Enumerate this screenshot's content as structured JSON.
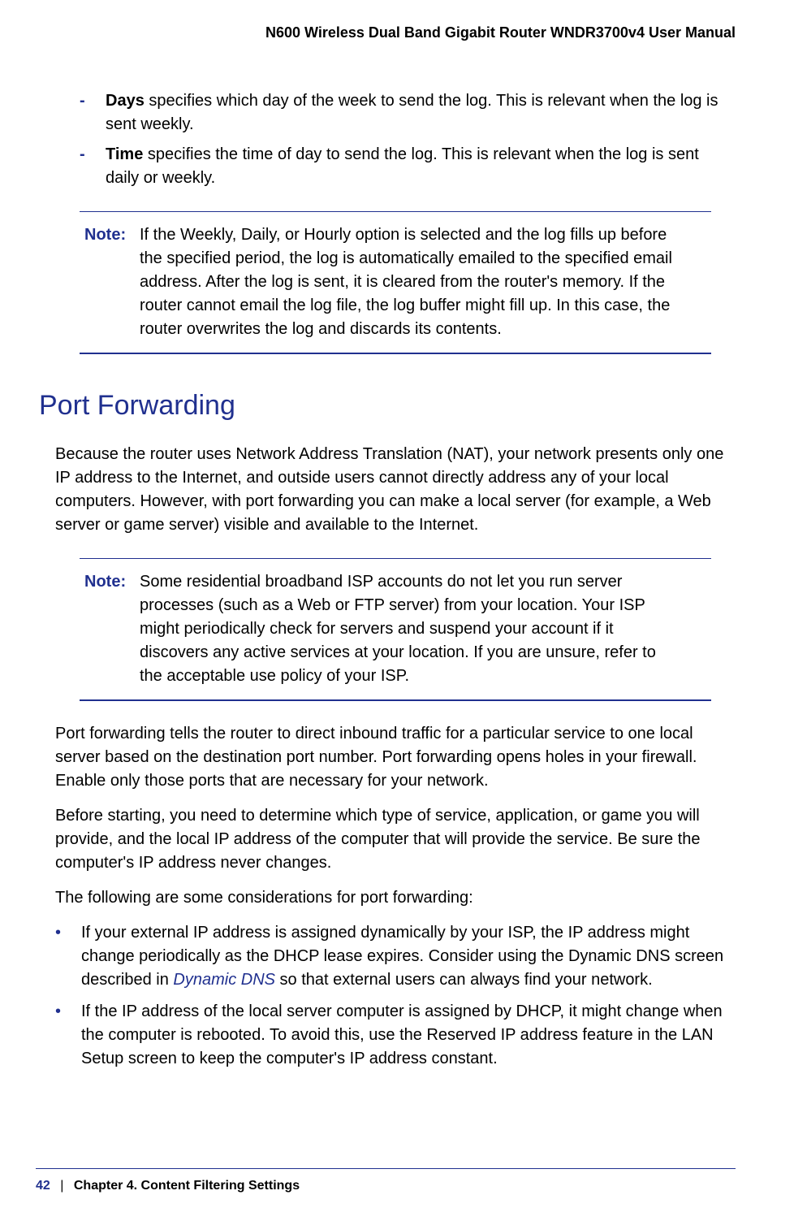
{
  "header": {
    "title": "N600 Wireless Dual Band Gigabit Router WNDR3700v4 User Manual"
  },
  "dash_items": [
    {
      "lead": "Days",
      "rest": " specifies which day of the week to send the log. This is relevant when the log is sent weekly."
    },
    {
      "lead": "Time",
      "rest": " specifies the time of day to send the log. This is relevant when the log is sent daily or weekly."
    }
  ],
  "note1": {
    "label": "Note:",
    "text": "If the Weekly, Daily, or Hourly option is selected and the log fills up before the specified period, the log is automatically emailed to the specified email address. After the log is sent, it is cleared from the router's memory. If the router cannot email the log file, the log buffer might fill up. In this case, the router overwrites the log and discards its contents."
  },
  "section_heading": "Port Forwarding",
  "para1": "Because the router uses Network Address Translation (NAT), your network presents only one IP address to the Internet, and outside users cannot directly address any of your local computers. However, with port forwarding you can make a local server (for example, a Web server or game server) visible and available to the Internet.",
  "note2": {
    "label": "Note:",
    "text": "Some residential broadband ISP accounts do not let you run server processes (such as a Web or FTP server) from your location. Your ISP might periodically check for servers and suspend your account if it discovers any active services at your location. If you are unsure, refer to the acceptable use policy of your ISP."
  },
  "para2": "Port forwarding tells the router to direct inbound traffic for a particular service to one local server based on the destination port number. Port forwarding opens holes in your firewall. Enable only those ports that are necessary for your network.",
  "para3": "Before starting, you need to determine which type of service, application, or game you will provide, and the local IP address of the computer that will provide the service. Be sure the computer's IP address never changes.",
  "para4": "The following are some considerations for port forwarding:",
  "bullet1": {
    "pre": "If your external IP address is assigned dynamically by your ISP, the IP address might change periodically as the DHCP lease expires. Consider using the Dynamic DNS screen described in ",
    "link": "Dynamic DNS",
    "post": " so that external users can always find your network."
  },
  "bullet2": "If the IP address of the local server computer is assigned by DHCP, it might change when the computer is rebooted. To avoid this, use the Reserved IP address feature in the LAN Setup screen to keep the computer's IP address constant.",
  "footer": {
    "page": "42",
    "sep": "|",
    "chapter": "Chapter 4.  Content Filtering Settings"
  }
}
